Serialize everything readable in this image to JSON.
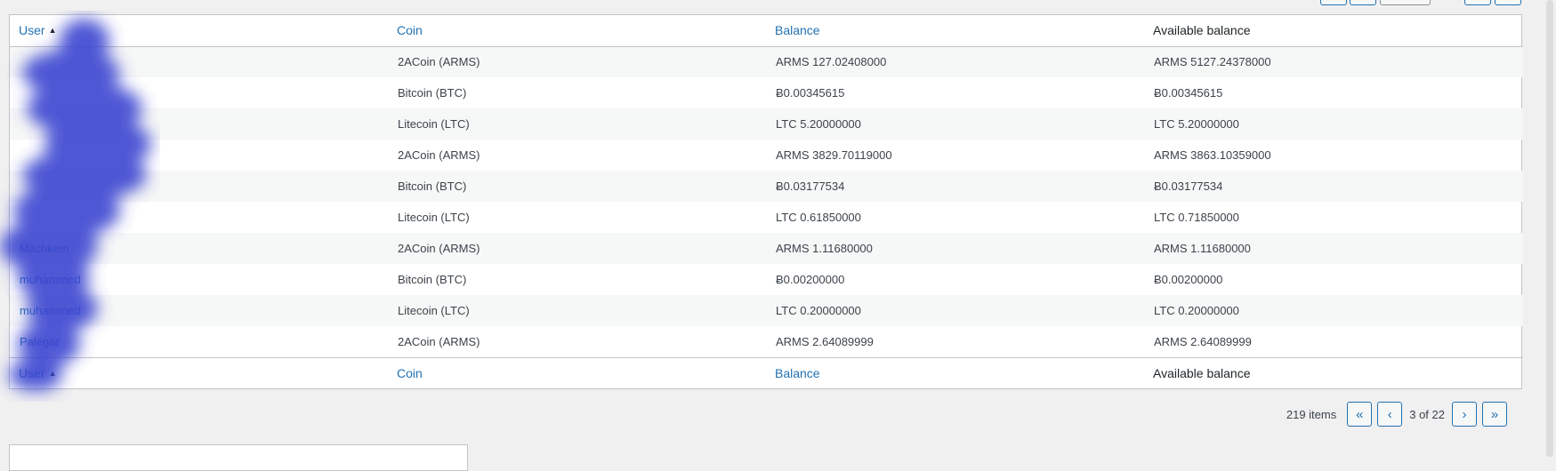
{
  "top_pagination": {},
  "table": {
    "headers": {
      "user": "User",
      "coin": "Coin",
      "balance": "Balance",
      "available": "Available balance"
    },
    "sorted_column": "user",
    "sort_direction": "asc",
    "rows": [
      {
        "user": "",
        "coin": "2ACoin (ARMS)",
        "balance": "ARMS 127.02408000",
        "available": "ARMS 5127.24378000"
      },
      {
        "user": "",
        "coin": "Bitcoin (BTC)",
        "balance": "Ƀ0.00345615",
        "available": "Ƀ0.00345615"
      },
      {
        "user": "",
        "coin": "Litecoin (LTC)",
        "balance": "LTC 5.20000000",
        "available": "LTC 5.20000000"
      },
      {
        "user": "",
        "coin": "2ACoin (ARMS)",
        "balance": "ARMS 3829.70119000",
        "available": "ARMS 3863.10359000"
      },
      {
        "user": "",
        "coin": "Bitcoin (BTC)",
        "balance": "Ƀ0.03177534",
        "available": "Ƀ0.03177534"
      },
      {
        "user": "",
        "coin": "Litecoin (LTC)",
        "balance": "LTC 0.61850000",
        "available": "LTC 0.71850000"
      },
      {
        "user": "Mitchkem",
        "coin": "2ACoin (ARMS)",
        "balance": "ARMS 1.11680000",
        "available": "ARMS 1.11680000"
      },
      {
        "user": "muhammed",
        "coin": "Bitcoin (BTC)",
        "balance": "Ƀ0.00200000",
        "available": "Ƀ0.00200000"
      },
      {
        "user": "muhammed",
        "coin": "Litecoin (LTC)",
        "balance": "LTC 0.20000000",
        "available": "LTC 0.20000000"
      },
      {
        "user": "Palegar",
        "coin": "2ACoin (ARMS)",
        "balance": "ARMS 2.64089999",
        "available": "ARMS 2.64089999"
      }
    ]
  },
  "pagination": {
    "items_count": "219 items",
    "first": "«",
    "prev": "‹",
    "position": "3 of 22",
    "next": "›",
    "last": "»"
  },
  "icons": {
    "sort": "sort-asc-icon"
  },
  "colors": {
    "link": "#2271b1",
    "border": "#c3c4c7",
    "background": "#f0f0f1",
    "redaction": "#3a45d0"
  }
}
